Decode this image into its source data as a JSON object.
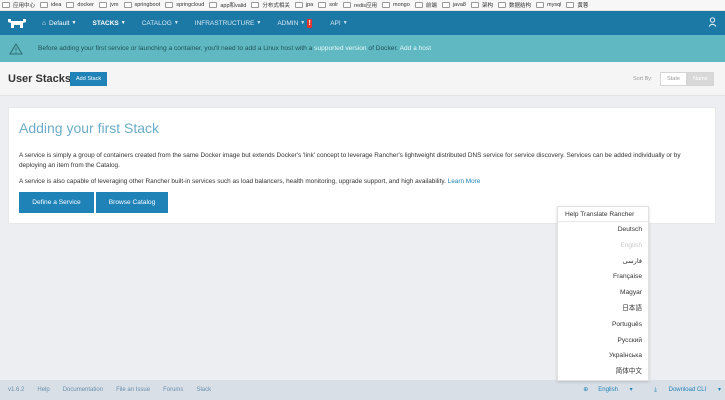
{
  "bookmarks": [
    "应用中心",
    "idea",
    "docker",
    "jvm",
    "springboot",
    "springcloud",
    "app和valid",
    "分布式相关",
    "jpa",
    "solr",
    "redis应用",
    "mongo",
    "前端",
    "java8",
    "架构",
    "数据结构",
    "mysql",
    "黄蓉"
  ],
  "nav": {
    "env_label": "Default",
    "items": [
      "STACKS",
      "CATALOG",
      "INFRASTRUCTURE",
      "ADMIN",
      "API"
    ]
  },
  "banner": {
    "text_before": "Before adding your first service or launching a container, you'll need to add a Linux host with a ",
    "link1": "supported version",
    "text_middle": " of Docker. ",
    "link2": "Add a host"
  },
  "header": {
    "title": "User Stacks",
    "add_button": "Add Stack",
    "sort_label": "Sort By:",
    "sort_state": "State",
    "sort_name": "Name"
  },
  "card": {
    "title": "Adding your first Stack",
    "p1": "A service is simply a group of containers created from the same Docker image but extends Docker's 'link' concept to leverage Rancher's lightweight distributed DNS service for service discovery. Services can be added individually or by deploying an item from the Catalog.",
    "p2_text": "A service is also capable of leveraging other Rancher built-in services such as load balancers, health monitoring, upgrade support, and high availability. ",
    "p2_link": "Learn More",
    "btn_define": "Define a Service",
    "btn_browse": "Browse Catalog"
  },
  "lang_menu": {
    "header": "Help Translate Rancher",
    "items": [
      "Deutsch",
      "English",
      "فارسی",
      "Française",
      "Magyar",
      "日本語",
      "Português",
      "Русский",
      "Українська",
      "简体中文"
    ],
    "disabled_index": 1
  },
  "footer": {
    "version": "v1.6.2",
    "links": [
      "Help",
      "Documentation",
      "File an Issue",
      "Forums",
      "Slack"
    ],
    "language": "English",
    "download": "Download CLI"
  }
}
